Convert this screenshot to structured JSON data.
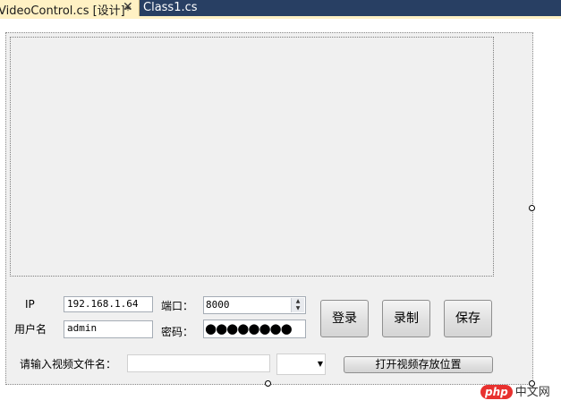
{
  "tabs": {
    "active_title": "VideoControl.cs [设计]*",
    "close_glyph": "✕",
    "inactive_title": "Class1.cs"
  },
  "form": {
    "ip_label": "IP",
    "ip_value": "192.168.1.64",
    "port_label": "端口：",
    "port_value": "8000",
    "username_label": "用户名",
    "username_value": "admin",
    "password_label": "密码：",
    "password_mask": "●●●●●●●●",
    "login_button": "登录",
    "record_button": "录制",
    "save_button": "保存",
    "filename_label": "请输入视频文件名：",
    "filename_value": "",
    "combo_value": "",
    "open_folder_button": "打开视频存放位置"
  },
  "watermark": {
    "badge": "php",
    "site": "中文网"
  },
  "colors": {
    "tabbar_bg": "#283f63",
    "active_tab_bg": "#fff1c4",
    "surface_bg": "#f0f0f0",
    "watermark_red": "#e8312f"
  },
  "icons": [
    "close-icon",
    "spin-up-icon",
    "spin-down-icon",
    "dropdown-arrow-icon"
  ]
}
